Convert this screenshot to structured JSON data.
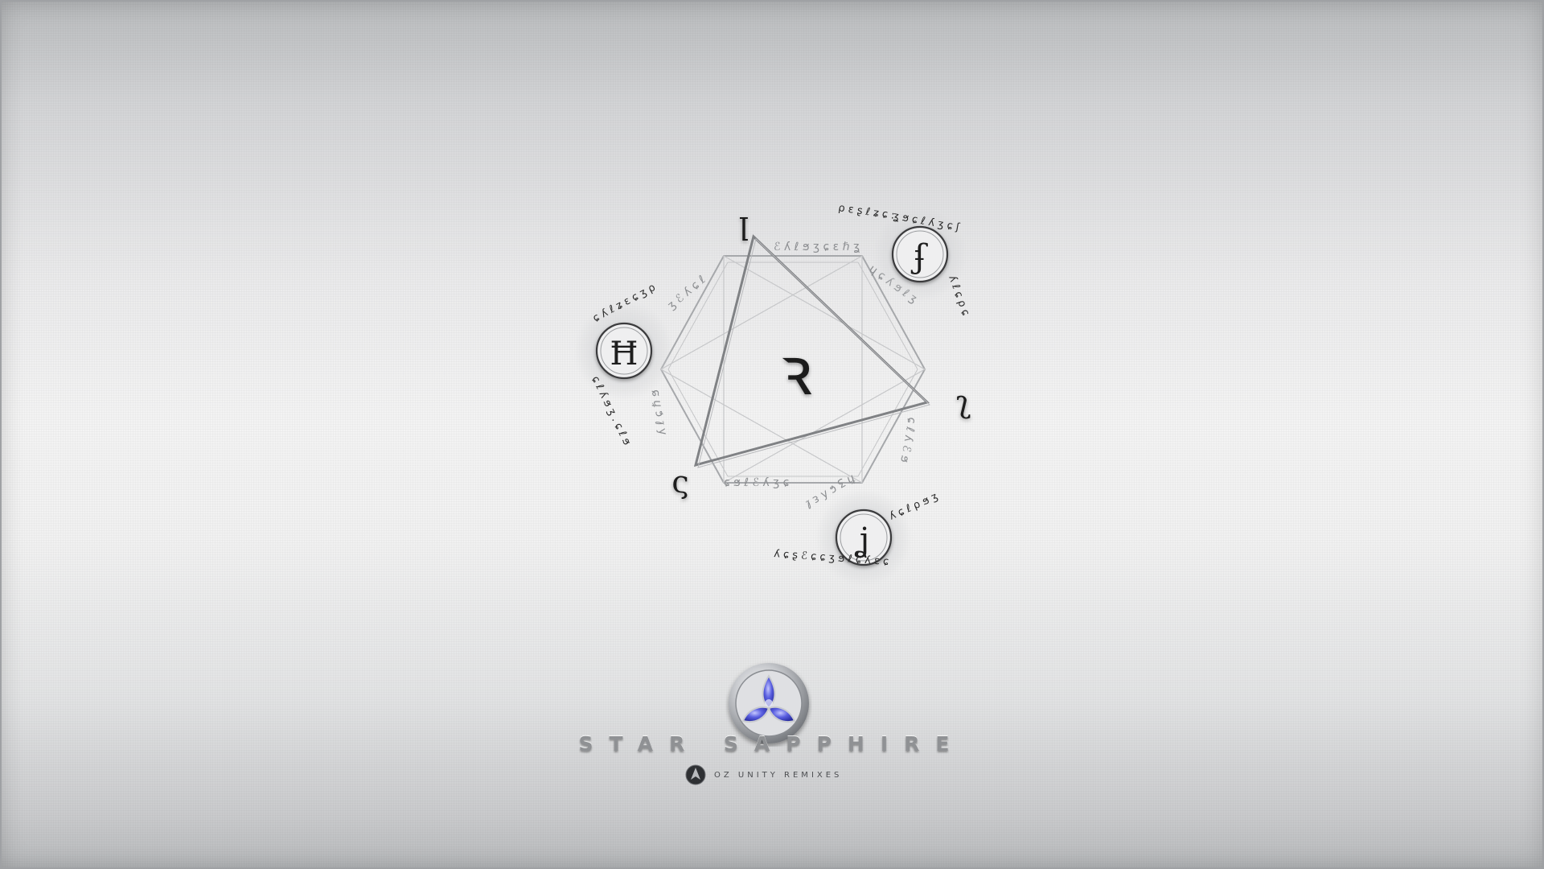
{
  "brand": {
    "title": "STAR SAPPHIRE",
    "subtitle": "OZ UNITY REMIXES"
  },
  "sigil": {
    "center_glyph": "ꝛ",
    "vertex_glyphs": [
      "ꞁ",
      "ʅ",
      "ς"
    ],
    "medallion_glyphs": [
      "ʄ",
      "Ħ",
      "ʝ"
    ],
    "icons": [
      "hexagram-sigil-icon",
      "triangle-icon",
      "emblem-medallion-icon"
    ]
  },
  "colors": {
    "background": "#eeeeef",
    "ink": "#1e1e1e",
    "line": "#8c8e91",
    "gem": "#4a4fcf",
    "metal": "#c5c7cb",
    "brand_text": "#8f9194"
  }
}
